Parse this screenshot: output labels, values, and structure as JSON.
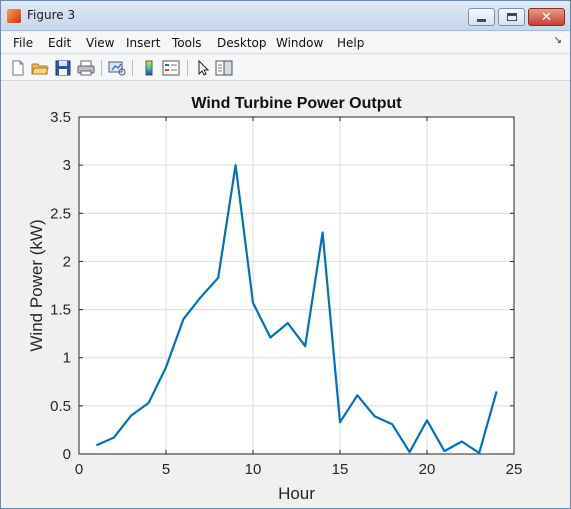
{
  "window": {
    "title": "Figure 3",
    "minimize_icon": "minimize-icon",
    "maximize_icon": "maximize-icon",
    "close_icon": "close-icon"
  },
  "menu": {
    "items": [
      "File",
      "Edit",
      "View",
      "Insert",
      "Tools",
      "Desktop",
      "Window",
      "Help"
    ]
  },
  "toolbar": {
    "buttons": [
      "new-figure-icon",
      "open-file-icon",
      "save-icon",
      "print-icon",
      "link-plot-icon",
      "colorbar-icon",
      "legend-icon",
      "pointer-icon",
      "property-editor-icon"
    ]
  },
  "colors": {
    "line": "#0072bd",
    "background": "#f0f0f0",
    "axes": "#ffffff"
  },
  "chart_data": {
    "type": "line",
    "title": "Wind Turbine Power Output",
    "xlabel": "Hour",
    "ylabel": "Wind Power (kW)",
    "xlim": [
      0,
      25
    ],
    "ylim": [
      0,
      3.5
    ],
    "xticks": [
      0,
      5,
      10,
      15,
      20,
      25
    ],
    "yticks": [
      0,
      0.5,
      1,
      1.5,
      2,
      2.5,
      3,
      3.5
    ],
    "xtick_labels": [
      "0",
      "5",
      "10",
      "15",
      "20",
      "25"
    ],
    "ytick_labels": [
      "0",
      "0.5",
      "1",
      "1.5",
      "2",
      "2.5",
      "3",
      "3.5"
    ],
    "grid": true,
    "series": [
      {
        "x": [
          1,
          2,
          3,
          4,
          5,
          6,
          7,
          8,
          9,
          10,
          11,
          12,
          13,
          14,
          15,
          16,
          17,
          18,
          19,
          20,
          21,
          22,
          23,
          24
        ],
        "values": [
          0.09,
          0.17,
          0.4,
          0.53,
          0.9,
          1.4,
          1.63,
          1.83,
          3.0,
          1.57,
          1.21,
          1.36,
          1.12,
          2.3,
          0.33,
          0.61,
          0.39,
          0.31,
          0.02,
          0.35,
          0.03,
          0.13,
          0.01,
          0.65
        ]
      }
    ]
  }
}
